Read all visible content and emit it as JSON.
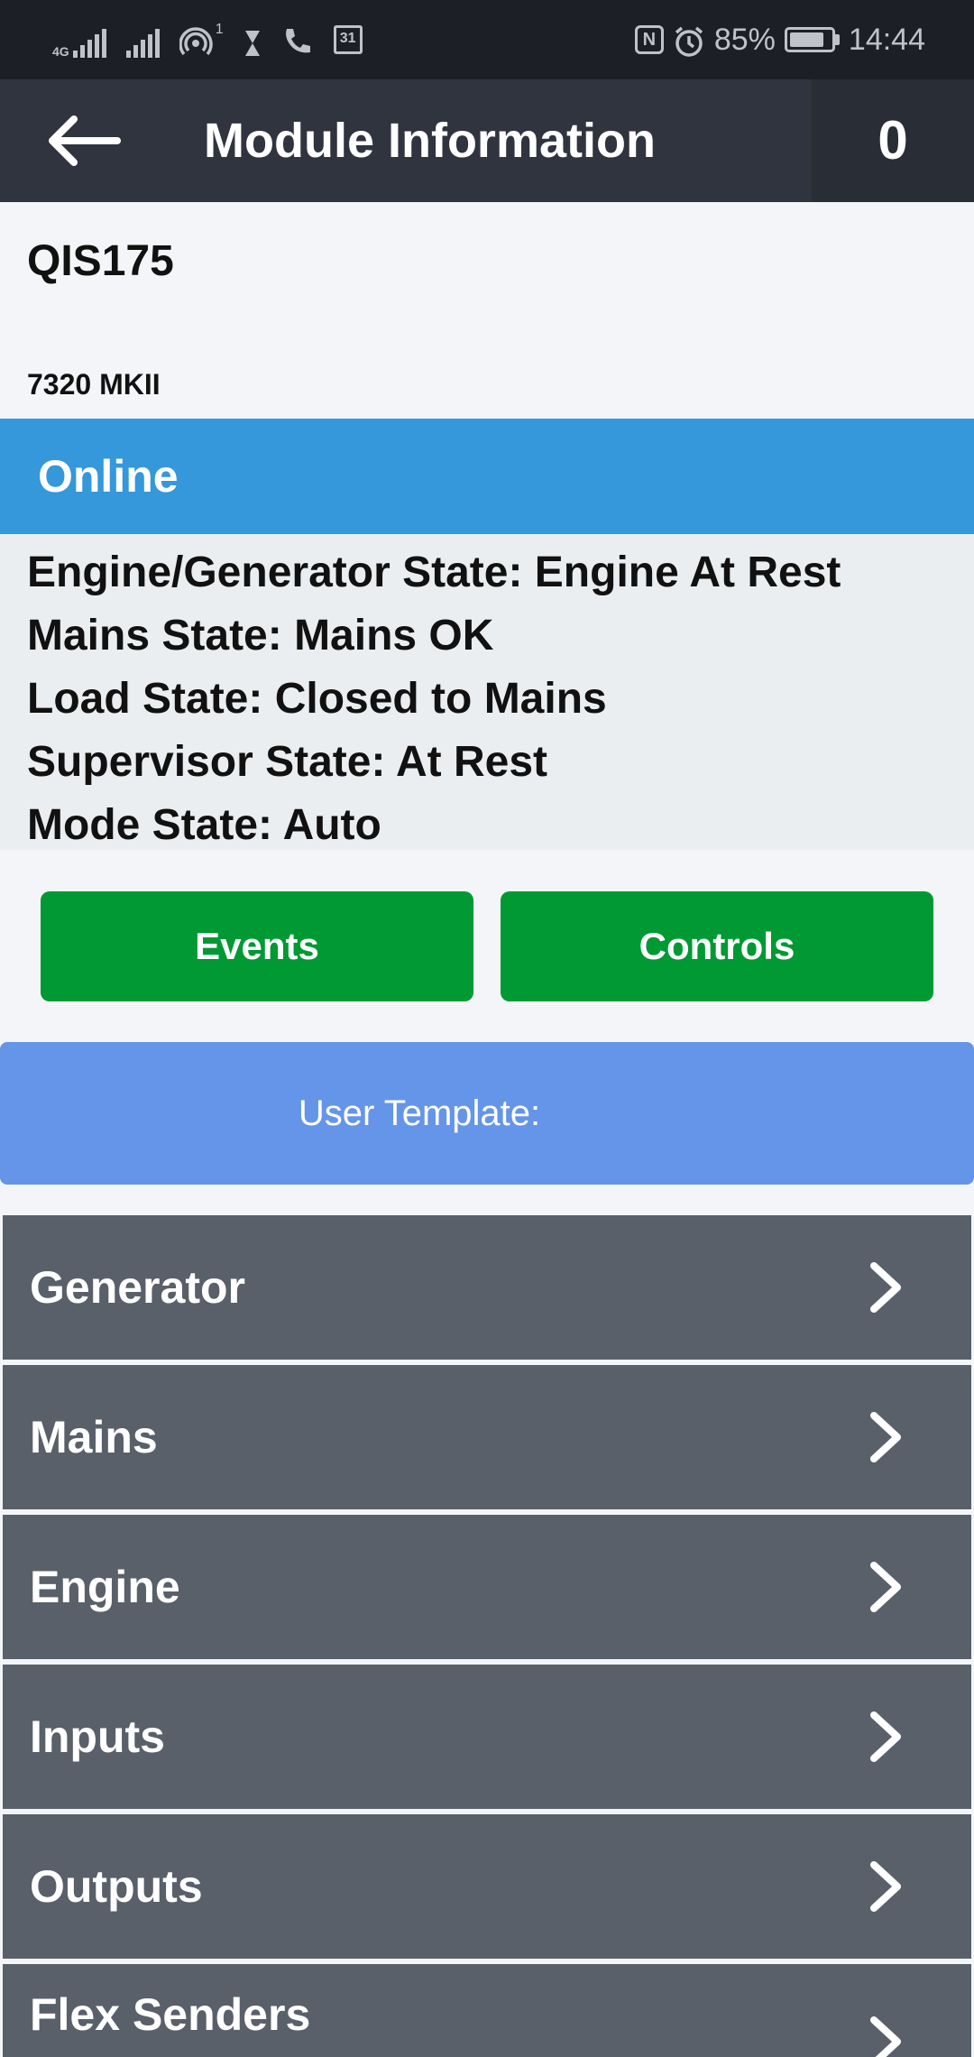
{
  "status_bar": {
    "network": "4G",
    "sim_slot": "1",
    "calendar_day": "31",
    "nfc": "N",
    "battery": "85%",
    "battery_level": 0.85,
    "time": "14:44"
  },
  "app_bar": {
    "title": "Module Information",
    "count": "0",
    "back_icon": "arrow-left-icon"
  },
  "module": {
    "name": "QIS175",
    "model": "7320 MKII"
  },
  "connection": {
    "status": "Online"
  },
  "states": [
    "Engine/Generator State: Engine At Rest",
    "Mains State: Mains OK",
    "Load State: Closed to Mains",
    "Supervisor State: At Rest",
    "Mode State: Auto"
  ],
  "buttons": {
    "events": "Events",
    "controls": "Controls"
  },
  "template": {
    "label": "User Template:"
  },
  "menu": [
    {
      "label": "Generator"
    },
    {
      "label": "Mains"
    },
    {
      "label": "Engine"
    },
    {
      "label": "Inputs"
    },
    {
      "label": "Outputs"
    },
    {
      "label": "Flex Senders"
    }
  ],
  "colors": {
    "app_bar": "#2f343e",
    "online": "#3498db",
    "button_green": "#009933",
    "template_blue": "#6495e8",
    "menu_gray": "#5a6069"
  }
}
